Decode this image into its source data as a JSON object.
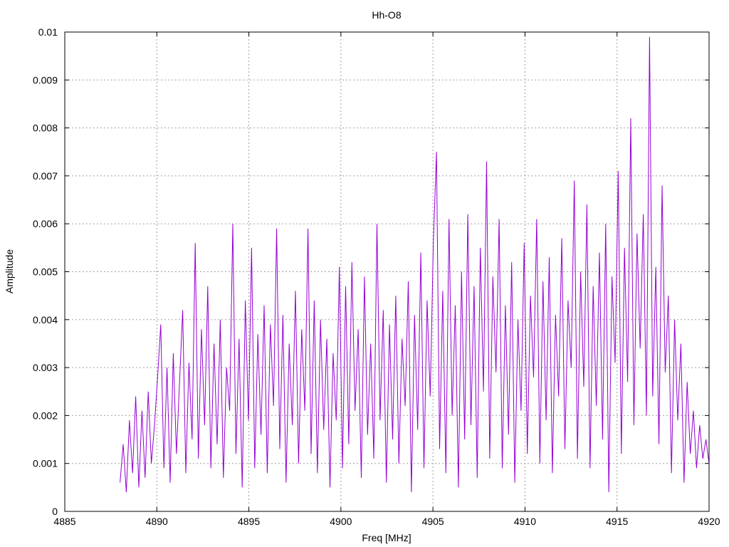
{
  "chart_data": {
    "type": "line",
    "title": "Hh-O8",
    "xlabel": "Freq [MHz]",
    "ylabel": "Amplitude",
    "xlim": [
      4885,
      4920
    ],
    "ylim": [
      0,
      0.01
    ],
    "xticks": [
      "4885",
      "4890",
      "4895",
      "4900",
      "4905",
      "4910",
      "4915",
      "4920"
    ],
    "yticks": [
      "0",
      "0.001",
      "0.002",
      "0.003",
      "0.004",
      "0.005",
      "0.006",
      "0.007",
      "0.008",
      "0.009",
      "0.01"
    ],
    "grid": true,
    "legend": "none",
    "series": [
      {
        "name": "Hh-O8",
        "color": "#9400d3",
        "x_range": [
          4888,
          4920
        ],
        "values": [
          0.0006,
          0.0014,
          0.0004,
          0.0019,
          0.0008,
          0.0024,
          0.0005,
          0.0021,
          0.0007,
          0.0025,
          0.001,
          0.0018,
          0.0028,
          0.0039,
          0.0009,
          0.003,
          0.0006,
          0.0033,
          0.0012,
          0.0027,
          0.0042,
          0.0008,
          0.0031,
          0.0015,
          0.0056,
          0.0011,
          0.0038,
          0.0018,
          0.0047,
          0.0009,
          0.0035,
          0.0014,
          0.004,
          0.0007,
          0.003,
          0.0021,
          0.006,
          0.0012,
          0.0036,
          0.0005,
          0.0044,
          0.0019,
          0.0055,
          0.0009,
          0.0037,
          0.0016,
          0.0043,
          0.0008,
          0.0039,
          0.0022,
          0.0059,
          0.0013,
          0.0041,
          0.0006,
          0.0035,
          0.0018,
          0.0046,
          0.001,
          0.0038,
          0.0021,
          0.0059,
          0.0012,
          0.0044,
          0.0008,
          0.004,
          0.0017,
          0.0036,
          0.0005,
          0.0033,
          0.0019,
          0.0051,
          0.0009,
          0.0047,
          0.0014,
          0.0052,
          0.0021,
          0.0038,
          0.0007,
          0.0049,
          0.0016,
          0.0035,
          0.0011,
          0.006,
          0.0019,
          0.0042,
          0.0006,
          0.0039,
          0.0015,
          0.0045,
          0.001,
          0.0036,
          0.0022,
          0.0048,
          0.0004,
          0.0041,
          0.0017,
          0.0054,
          0.0009,
          0.0044,
          0.0024,
          0.0056,
          0.0075,
          0.0013,
          0.0046,
          0.0008,
          0.0061,
          0.002,
          0.0043,
          0.0005,
          0.005,
          0.0015,
          0.0062,
          0.0018,
          0.0047,
          0.0007,
          0.0055,
          0.0025,
          0.0073,
          0.0011,
          0.0049,
          0.0029,
          0.0061,
          0.0009,
          0.0043,
          0.0016,
          0.0052,
          0.0006,
          0.004,
          0.0021,
          0.0056,
          0.0012,
          0.0045,
          0.0028,
          0.0061,
          0.001,
          0.0048,
          0.0019,
          0.0053,
          0.0008,
          0.0041,
          0.0024,
          0.0057,
          0.0013,
          0.0044,
          0.003,
          0.0069,
          0.0011,
          0.005,
          0.0026,
          0.0064,
          0.0009,
          0.0047,
          0.0022,
          0.0054,
          0.0015,
          0.006,
          0.0004,
          0.0049,
          0.0031,
          0.0071,
          0.0012,
          0.0055,
          0.0027,
          0.0082,
          0.0018,
          0.0058,
          0.0034,
          0.0062,
          0.002,
          0.0099,
          0.0024,
          0.0051,
          0.0014,
          0.0068,
          0.0029,
          0.0045,
          0.0008,
          0.004,
          0.0019,
          0.0035,
          0.0006,
          0.0027,
          0.0012,
          0.0021,
          0.0009,
          0.0018,
          0.0011,
          0.0015,
          0.001
        ]
      }
    ]
  }
}
